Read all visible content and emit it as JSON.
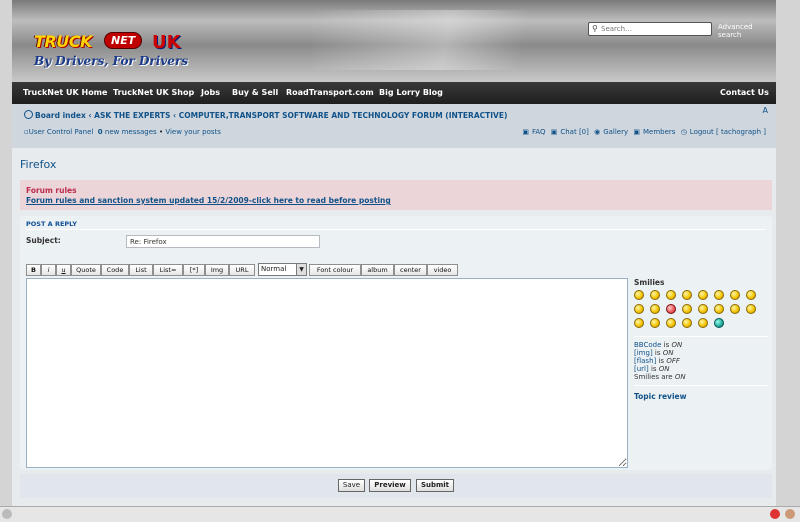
{
  "header": {
    "logo_truck": "TRUCK",
    "logo_net": "NET",
    "logo_uk": "UK",
    "slogan": "By Drivers, For Drivers",
    "search_placeholder": "Search…",
    "advanced_search": "Advanced search"
  },
  "nav": {
    "items": [
      "TruckNet UK Home",
      "TruckNet UK Shop",
      "Jobs",
      "Buy & Sell",
      "RoadTransport.com",
      "Big Lorry Blog"
    ],
    "contact": "Contact Us"
  },
  "breadcrumb": {
    "items": [
      "Board index",
      "ASK THE EXPERTS",
      "COMPUTER,TRANSPORT SOFTWARE AND TECHNOLOGY FORUM (INTERACTIVE)"
    ],
    "separator": "‹",
    "font_size_control": "A"
  },
  "user_bar": {
    "ucp": "User Control Panel",
    "messages_count": "0",
    "messages_label": "new messages",
    "view_posts": "View your posts",
    "faq": "FAQ",
    "chat": "Chat [0]",
    "gallery": "Gallery",
    "members": "Members",
    "logout": "Logout [ tachograph ]"
  },
  "page": {
    "title": "Firefox"
  },
  "rules": {
    "heading": "Forum rules",
    "link": "Forum rules and sanction system updated 15/2/2009-click here to read before posting"
  },
  "post": {
    "heading": "POST A REPLY",
    "subject_label": "Subject:",
    "subject_value": "Re: Firefox",
    "font_size_value": "Normal",
    "toolbar": [
      "B",
      "i",
      "u",
      "Quote",
      "Code",
      "List",
      "List=",
      "[*]",
      "Img",
      "URL"
    ],
    "toolbar2": [
      "Font colour",
      "album",
      "center",
      "video"
    ],
    "message": ""
  },
  "sidebar": {
    "smilies_label": "Smilies",
    "status": [
      {
        "key": "BBCode",
        "state": "ON"
      },
      {
        "key": "[img]",
        "state": "ON"
      },
      {
        "key": "[flash]",
        "state": "OFF"
      },
      {
        "key": "[url]",
        "state": "ON"
      },
      {
        "key": "Smilies",
        "state": "ON"
      }
    ],
    "status_text": {
      "is": "is",
      "are": "are"
    },
    "topic_review": "Topic review"
  },
  "buttons": {
    "save": "Save",
    "preview": "Preview",
    "submit": "Submit"
  },
  "colors": {
    "link": "#105289",
    "rules_bg": "#ecd5d8",
    "rules_heading": "#bc2a4d"
  }
}
